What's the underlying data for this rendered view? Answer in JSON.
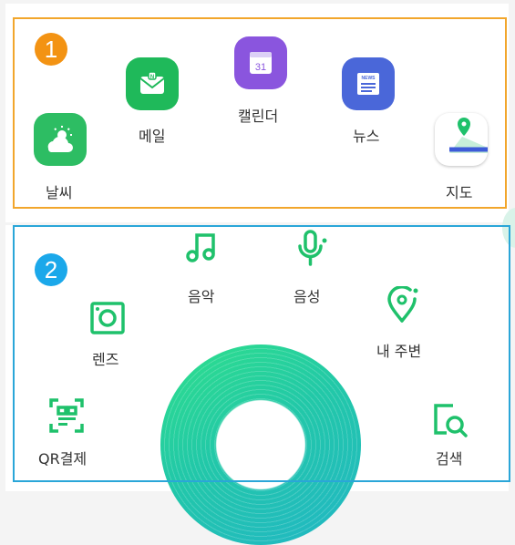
{
  "section1": {
    "badge": "1",
    "apps": [
      {
        "label": "날씨",
        "icon": "weather-icon",
        "color": "#2dbd63"
      },
      {
        "label": "메일",
        "icon": "mail-icon",
        "color": "#1fb95a"
      },
      {
        "label": "캘린더",
        "icon": "calendar-icon",
        "color": "#8a55de",
        "date": "31"
      },
      {
        "label": "뉴스",
        "icon": "news-icon",
        "color": "#4a67d9",
        "tag": "NEWS"
      },
      {
        "label": "지도",
        "icon": "map-icon",
        "color": "#ffffff"
      }
    ]
  },
  "section2": {
    "badge": "2",
    "tools": [
      {
        "label": "음악",
        "icon": "music-icon"
      },
      {
        "label": "음성",
        "icon": "microphone-icon"
      },
      {
        "label": "렌즈",
        "icon": "lens-icon"
      },
      {
        "label": "내 주변",
        "icon": "location-pin-icon"
      },
      {
        "label": "QR결제",
        "icon": "qr-code-icon"
      },
      {
        "label": "검색",
        "icon": "search-icon"
      }
    ]
  },
  "colors": {
    "accent_green": "#1fc16b",
    "highlight_orange": "#f2a62c",
    "highlight_blue": "#2aa6d8"
  }
}
